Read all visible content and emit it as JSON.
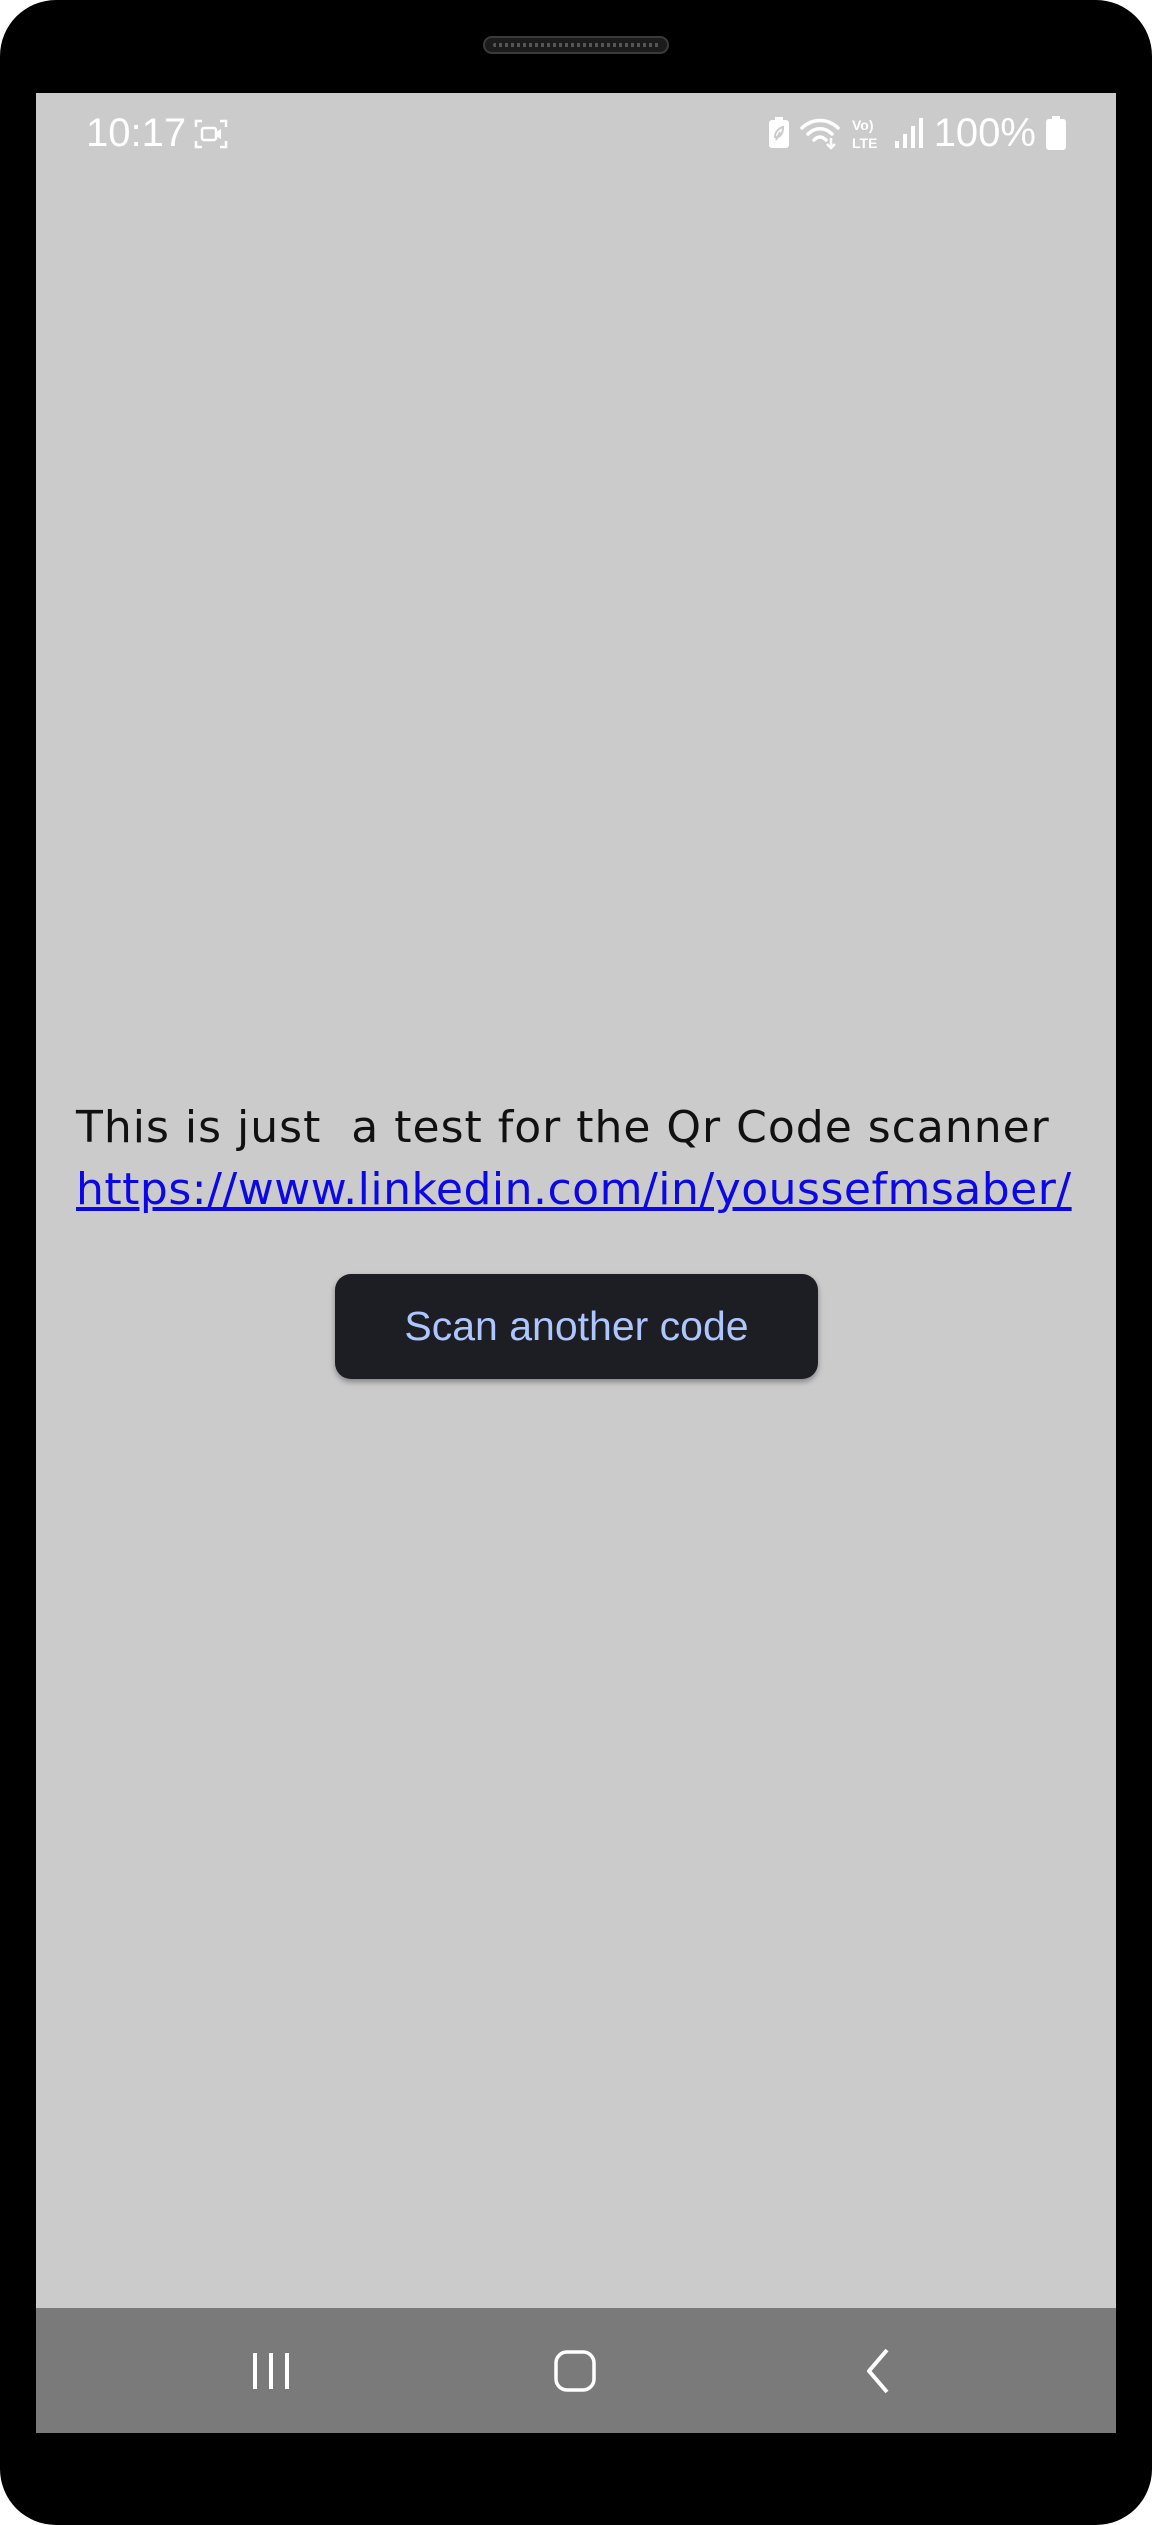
{
  "status_bar": {
    "time": "10:17",
    "battery_percent": "100%",
    "network_label": "LTE"
  },
  "content": {
    "message": "This is just  a test for the Qr Code scanner",
    "link_text": "https://www.linkedin.com/in/youssefmsaber/"
  },
  "actions": {
    "scan_button_label": "Scan another code"
  },
  "colors": {
    "screen_background": "#cbcbcb",
    "link": "#0b07e6",
    "button_background": "#1d1e23",
    "button_text": "#aec6ff",
    "nav_bar": "#7a7a7a"
  }
}
